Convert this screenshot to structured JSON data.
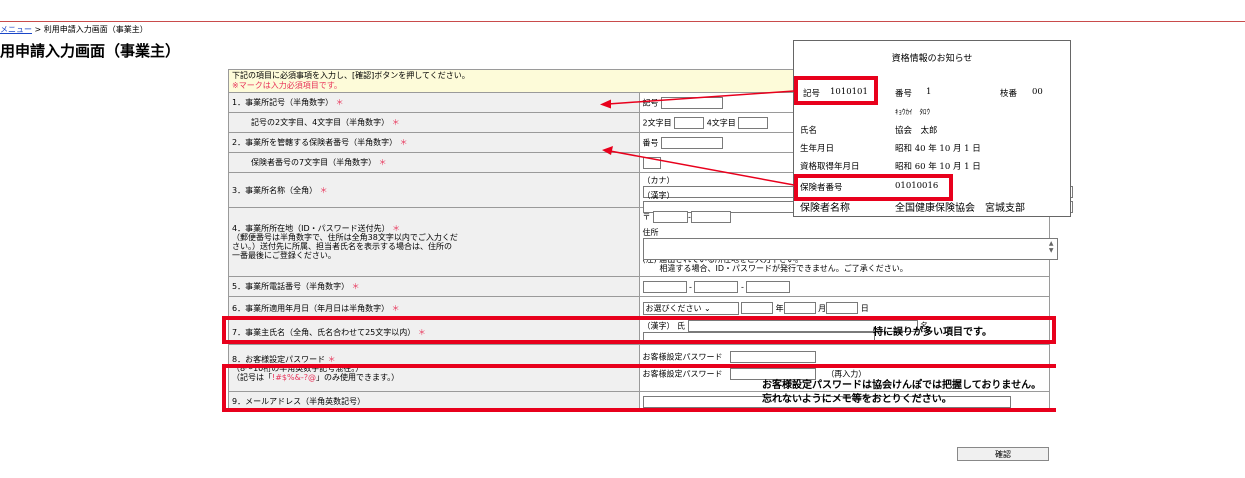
{
  "breadcrumb": {
    "menu_link": "メニュー",
    "separator": " > ",
    "current": "利用申請入力画面（事業主）"
  },
  "page_title": "用申請入力画面（事業主）",
  "instruction": {
    "line1": "下記の項目に必須事項を入力し、[確認]ボタンを押してください。",
    "line2": "※マークは入力必須項目です。"
  },
  "required_mark": "＊",
  "rows": {
    "r1": {
      "label": "1．事業所記号（半角数字）",
      "field_label": "記号"
    },
    "r1b": {
      "label": "記号の2文字目、4文字目（半角数字）",
      "field_a": "2文字目",
      "field_b": "4文字目"
    },
    "r2": {
      "label": "2．事業所を管轄する保険者番号（半角数字）",
      "field_label": "番号"
    },
    "r2b": {
      "label": "保険者番号の7文字目（半角数字）"
    },
    "r3": {
      "label": "3．事業所名称（全角）",
      "kana": "（カナ）",
      "kanji": "（漢字）"
    },
    "r4": {
      "label_l1": "4．事業所所在地（ID・パスワード送付先）",
      "label_l2": "（郵便番号は半角数字で、住所は全角38文字以内でご入力くだ",
      "label_l3": "さい。）送付先に所属、担当者氏名を表示する場合は、住所の",
      "label_l4": "一番最後にご登録ください。",
      "zip_mark": "〒",
      "dash": "-",
      "addr_label": "住所",
      "note_l1": "(注) 届出されている所在地をご入力下さい。",
      "note_l2": "相違する場合、ID・パスワードが発行できません。ご了承ください。"
    },
    "r5": {
      "label": "5．事業所電話番号（半角数字）",
      "dash": "-"
    },
    "r6": {
      "label": "6．事業所適用年月日（年月日は半角数字）",
      "select": "お選びください",
      "year": "年",
      "month": "月",
      "day": "日"
    },
    "r7": {
      "label": "7．事業主氏名（全角、氏名合わせて25文字以内）",
      "kanji": "（漢字）",
      "sei": "氏",
      "mei": "名"
    },
    "r8": {
      "label_l1": "8．お客様設定パスワード",
      "label_l2": "（8～10桁の半角英数字記号混在。）",
      "label_l3_a": "（記号は「",
      "label_l3_b": "!#$%&-?@",
      "label_l3_c": "」のみ使用できます。）",
      "pw": "お客様設定パスワード",
      "pw2": "お客様設定パスワード",
      "reenter": "（再入力）"
    },
    "r9": {
      "label": "9．メールアドレス（半角英数記号）"
    }
  },
  "confirm_button": "確認",
  "popup": {
    "title": "資格情報のお知らせ",
    "kigo_label": "記号",
    "kigo_value": "1010101",
    "bango_label": "番号",
    "bango_value": "1",
    "edaban_label": "枝番",
    "edaban_value": "00",
    "kana": "ｷｮｳｶｲ　ﾀﾛｳ",
    "name_label": "氏名",
    "name_value": "協会　太郎",
    "birth_label": "生年月日",
    "birth_value": "昭和 40 年 10 月 1 日",
    "acq_label": "資格取得年月日",
    "acq_value": "昭和 60 年 10 月 1 日",
    "insurer_no_label": "保険者番号",
    "insurer_no_value": "01010016",
    "insurer_name_label": "保険者名称",
    "insurer_name_value": "全国健康保険協会　宮城支部"
  },
  "notes": {
    "error_prone": "特に誤りが多い項目です。",
    "pw_l1": "お客様設定パスワードは協会けんぽでは把握しておりません。",
    "pw_l2": "忘れないようにメモ等をおとりください。"
  },
  "colors": {
    "highlight": "#e8001c",
    "required": "#e8345a",
    "instruction_bg": "#fdfbd9",
    "label_bg": "#f0f0f0"
  }
}
